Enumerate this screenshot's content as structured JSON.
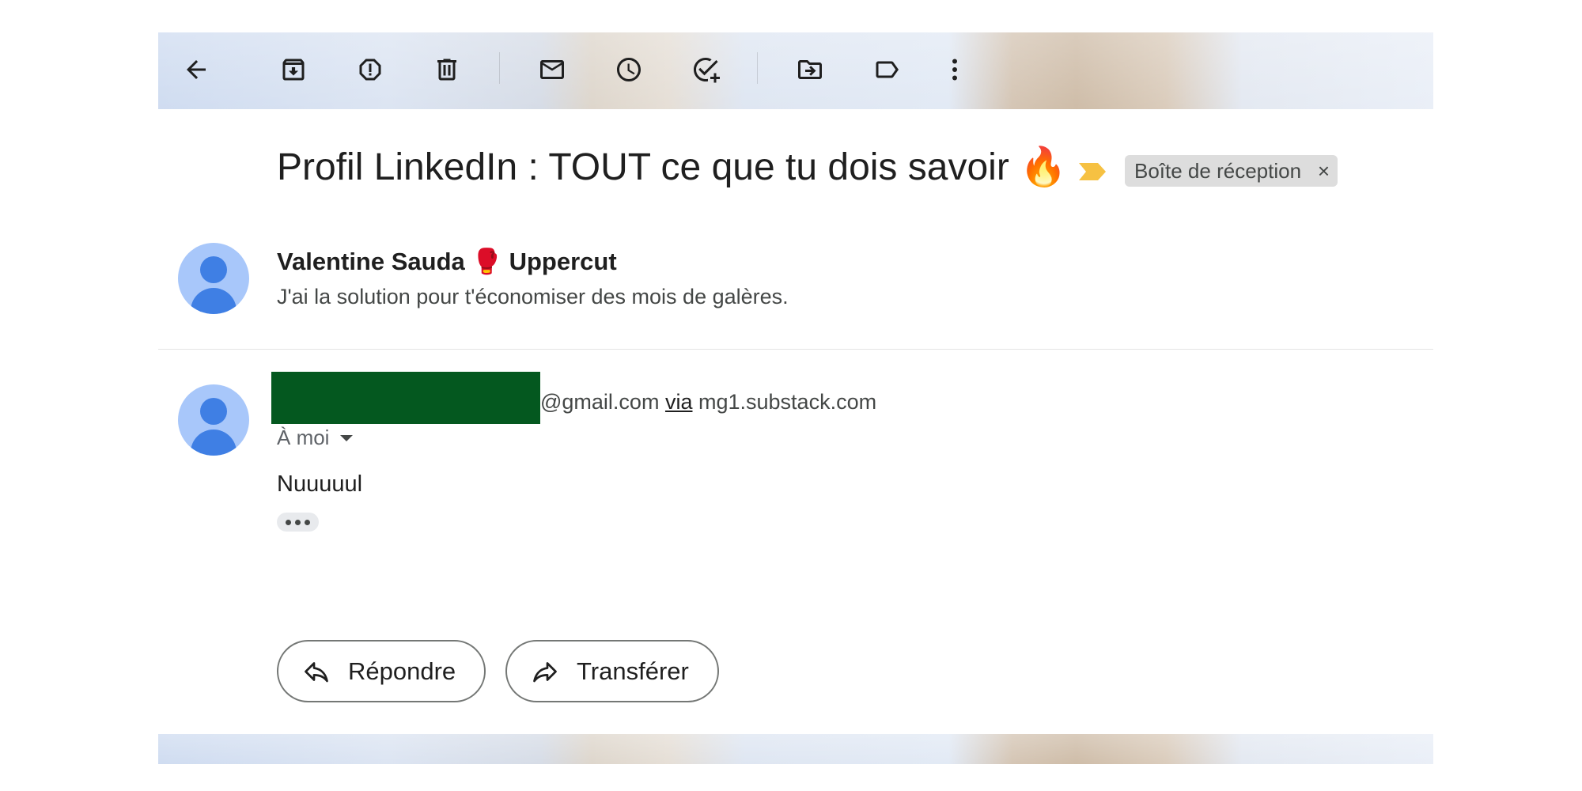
{
  "toolbar": {
    "icons": [
      "back-arrow-icon",
      "archive-icon",
      "report-spam-icon",
      "delete-icon",
      "mark-unread-icon",
      "snooze-icon",
      "add-task-icon",
      "move-to-icon",
      "label-icon",
      "more-vert-icon"
    ]
  },
  "email": {
    "subject": "Profil LinkedIn : TOUT ce que tu dois savoir 🔥",
    "label_chip": "Boîte de réception",
    "label_chip_close": "×",
    "importance_color": "#f6c142"
  },
  "thread": {
    "collapsed_message": {
      "sender": "Valentine Sauda 🥊 Uppercut",
      "snippet": "J'ai la solution pour t'économiser des mois de galères."
    },
    "open_message": {
      "from_domain": "@gmail.com",
      "via_label": "via",
      "via_domain": "mg1.substack.com",
      "to": "À moi",
      "body": "Nuuuuul"
    }
  },
  "actions": {
    "reply": "Répondre",
    "forward": "Transférer"
  },
  "colors": {
    "avatar_bg": "#a8c7fa",
    "avatar_fg": "#3f7fe4",
    "redaction": "#04581f"
  }
}
